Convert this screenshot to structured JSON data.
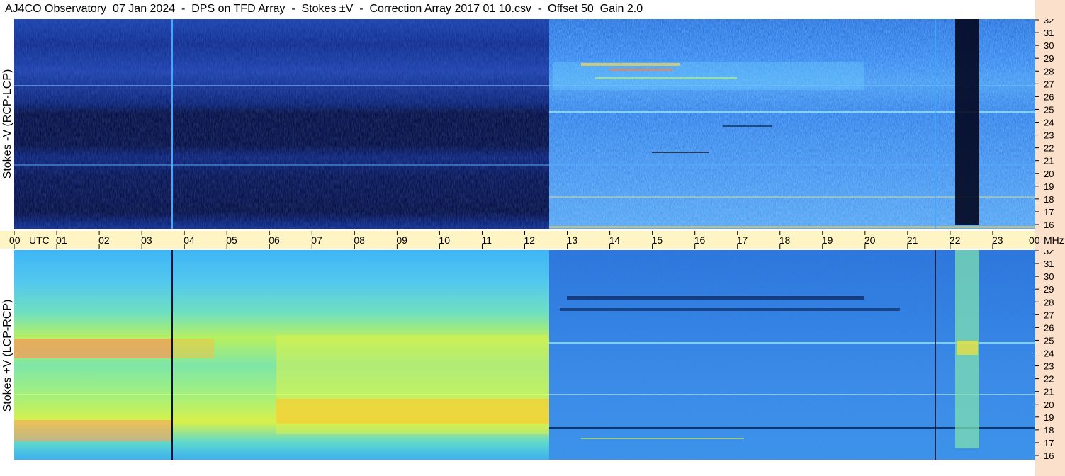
{
  "title": "AJ4CO Observatory  07 Jan 2024  -  DPS on TFD Array  -  Stokes ±V  -  Correction Array 2017 01 10.csv  -  Offset 50  Gain 2.0",
  "panel_labels": {
    "top": "Stokes -V (RCP-LCP)",
    "bottom": "Stokes +V (LCP-RCP)"
  },
  "time_axis": {
    "unit_label": "UTC",
    "freq_unit_label": "MHz",
    "ticks": [
      "00",
      "01",
      "02",
      "03",
      "04",
      "05",
      "06",
      "07",
      "08",
      "09",
      "10",
      "11",
      "12",
      "13",
      "14",
      "15",
      "16",
      "17",
      "18",
      "19",
      "20",
      "21",
      "22",
      "23",
      "00"
    ]
  },
  "freq_axis": {
    "ticks": [
      "32",
      "31",
      "30",
      "29",
      "28",
      "27",
      "26",
      "25",
      "24",
      "23",
      "22",
      "21",
      "20",
      "19",
      "18",
      "17",
      "16"
    ]
  },
  "colors": {
    "frame_right": "#fbe0cb",
    "time_axis_band": "#fff5c4"
  },
  "chart_data": [
    {
      "type": "heatmap",
      "name": "Stokes -V (RCP-LCP)",
      "x_range_utc_hours": [
        0,
        24
      ],
      "y_range_mhz": [
        16,
        32
      ],
      "features": {
        "dark_low_intensity_period_utc": [
          0,
          12.55
        ],
        "broadband_bright_band_utc_mhz": [
          [
            12.55,
            24,
            27,
            29
          ]
        ],
        "vertical_line_utc": [
          3.7,
          21.65
        ],
        "dark_column_utc": [
          22.1,
          22.6
        ]
      }
    },
    {
      "type": "heatmap",
      "name": "Stokes +V (LCP-RCP)",
      "x_range_utc_hours": [
        0,
        24
      ],
      "y_range_mhz": [
        16,
        32
      ],
      "features": {
        "bright_band_utc_mhz": [
          [
            0,
            3.7,
            24.5,
            25.3
          ],
          [
            0,
            3.7,
            17.5,
            18.7
          ],
          [
            6.1,
            12.55,
            19,
            20.2
          ]
        ],
        "vertical_line_utc": [
          3.7,
          21.65
        ],
        "bright_column_utc": [
          22.1,
          22.6
        ]
      }
    }
  ]
}
